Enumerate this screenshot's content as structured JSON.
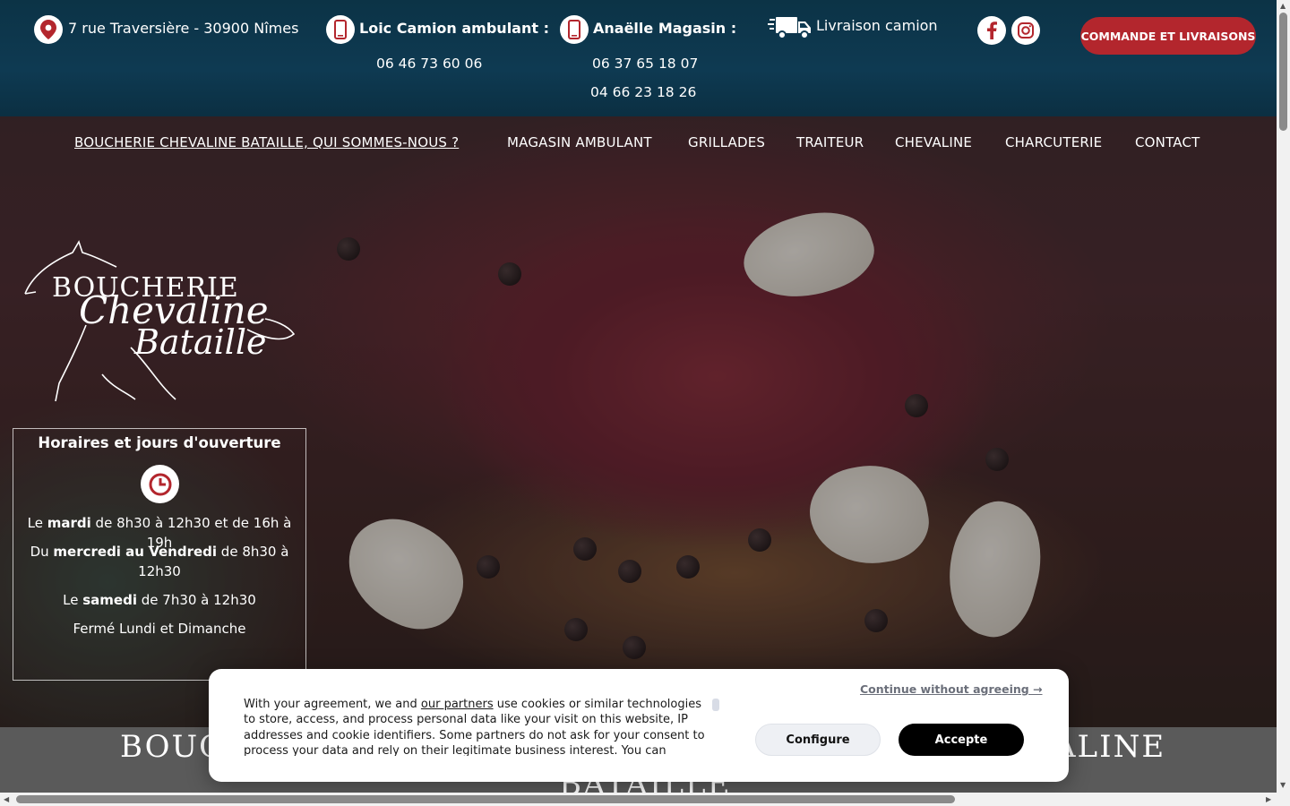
{
  "header": {
    "address": "7 rue Traversière - 30900 Nîmes",
    "contact_loic": {
      "label": "Loic Camion ambulant :",
      "phone": "06 46 73 60 06"
    },
    "contact_anaelle": {
      "label": "Anaëlle  Magasin :",
      "phones": [
        "06 37 65 18 07",
        "04 66 23 18 26"
      ]
    },
    "delivery": "Livraison camion",
    "cta": "COMMANDE ET LIVRAISONS"
  },
  "nav": {
    "items": [
      "BOUCHERIE CHEVALINE BATAILLE, QUI SOMMES-NOUS ?",
      "MAGASIN AMBULANT",
      "GRILLADES",
      "TRAITEUR",
      "CHEVALINE",
      "CHARCUTERIE",
      "CONTACT"
    ]
  },
  "logo": {
    "line1": "BOUCHERIE",
    "line2": "Chevaline",
    "line3": "Bataille"
  },
  "hours": {
    "title": "Horaires et jours d'ouverture",
    "l1_pre": "Le ",
    "l1_bold": "mardi",
    "l1_post": " de 8h30 à 12h30 et de 16h à 19h",
    "l2_pre": "Du ",
    "l2_bold": "mercredi au Vendredi",
    "l2_post": " de 8h30 à 12h30",
    "l3_pre": "Le ",
    "l3_bold": "samedi",
    "l3_post": " de 7h30 à 12h30",
    "l4": "Fermé Lundi et Dimanche"
  },
  "band": {
    "title_left": "BOUC",
    "title_right": "ALINE",
    "title_line2": "BATAILLE"
  },
  "cookie": {
    "text_pre": "With your agreement, we and ",
    "partners_link": "our partners",
    "text_post": " use cookies or similar technologies to store, access, and process personal data like your visit on this website, IP addresses and cookie identifiers. Some partners do not ask for your consent to process your data and rely on their legitimate business interest. You can",
    "continue": "Continue without agreeing →",
    "configure": "Configure",
    "accept": "Accepte"
  },
  "colors": {
    "header_bg": "#0e3a52",
    "accent_red": "#b3262d",
    "band_bg": "#5a5a5a"
  }
}
